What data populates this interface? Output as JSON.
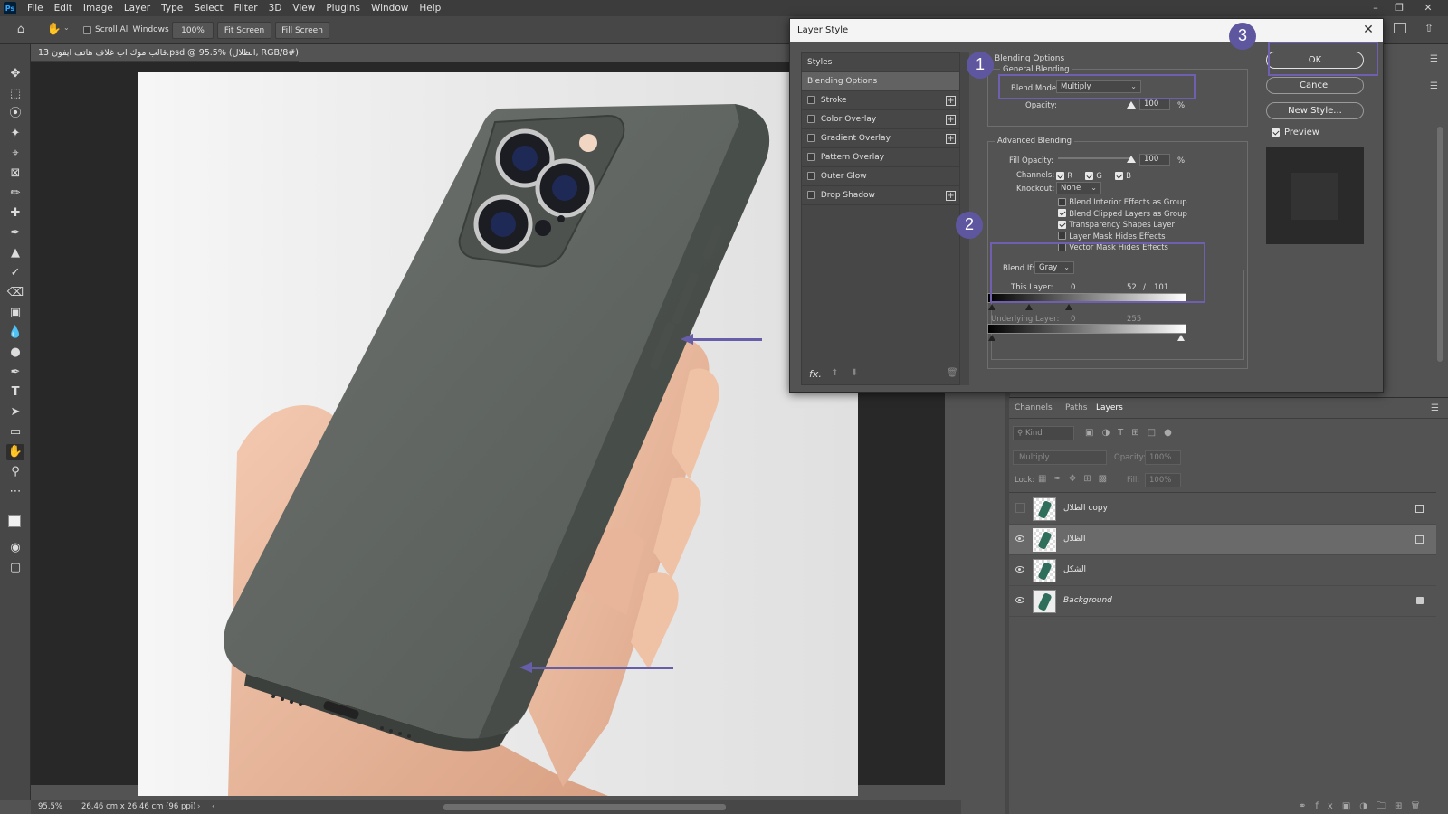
{
  "menubar": {
    "app_logo": "Ps",
    "items": [
      "File",
      "Edit",
      "Image",
      "Layer",
      "Type",
      "Select",
      "Filter",
      "3D",
      "View",
      "Plugins",
      "Window",
      "Help"
    ]
  },
  "optionsbar": {
    "scroll_all_windows": "Scroll All Windows",
    "zoom": "100%",
    "fit_screen": "Fit Screen",
    "fill_screen": "Fill Screen"
  },
  "document": {
    "tab_title": "قالب موك اب غلاف هاتف ايفون 13.psd @ 95.5% (الظلال, RGB/8#) *",
    "status_zoom": "95.5%",
    "status_size": "26.46 cm x 26.46 cm (96 ppi)"
  },
  "dialog": {
    "title": "Layer Style",
    "styles_header": "Styles",
    "style_items": [
      {
        "label": "Blending Options",
        "checkbox": false,
        "plus": false
      },
      {
        "label": "Stroke",
        "checkbox": true,
        "plus": true
      },
      {
        "label": "Color Overlay",
        "checkbox": true,
        "plus": true
      },
      {
        "label": "Gradient Overlay",
        "checkbox": true,
        "plus": true
      },
      {
        "label": "Pattern Overlay",
        "checkbox": true,
        "plus": false
      },
      {
        "label": "Outer Glow",
        "checkbox": true,
        "plus": false
      },
      {
        "label": "Drop Shadow",
        "checkbox": true,
        "plus": true
      }
    ],
    "fx_label": "fx.",
    "blending_options": "Blending Options",
    "general_blending": "General Blending",
    "blend_mode_label": "Blend Mode:",
    "blend_mode_value": "Multiply",
    "opacity_label": "Opacity:",
    "opacity_value": "100",
    "percent": "%",
    "advanced_blending": "Advanced Blending",
    "fill_opacity_label": "Fill Opacity:",
    "fill_opacity_value": "100",
    "channels_label": "Channels:",
    "channels": [
      "R",
      "G",
      "B"
    ],
    "knockout_label": "Knockout:",
    "knockout_value": "None",
    "advanced_checks": [
      {
        "label": "Blend Interior Effects as Group",
        "checked": false
      },
      {
        "label": "Blend Clipped Layers as Group",
        "checked": true
      },
      {
        "label": "Transparency Shapes Layer",
        "checked": true
      },
      {
        "label": "Layer Mask Hides Effects",
        "checked": false
      },
      {
        "label": "Vector Mask Hides Effects",
        "checked": false
      }
    ],
    "blend_if_label": "Blend If:",
    "blend_if_value": "Gray",
    "this_layer_label": "This Layer:",
    "this_layer_low": "0",
    "this_layer_high_a": "52",
    "this_layer_sep": "/",
    "this_layer_high_b": "101",
    "underlying_label": "Underlying Layer:",
    "underlying_low": "0",
    "underlying_high": "255",
    "buttons": {
      "ok": "OK",
      "cancel": "Cancel",
      "new_style": "New Style..."
    },
    "preview_label": "Preview"
  },
  "layers_panel": {
    "tabs": [
      "Channels",
      "Paths",
      "Layers"
    ],
    "active_tab": "Layers",
    "kind_placeholder": "Kind",
    "blend_mode": "Multiply",
    "opacity_label": "Opacity:",
    "opacity_value": "100%",
    "lock_label": "Lock:",
    "fill_label": "Fill:",
    "fill_value": "100%",
    "layers": [
      {
        "name": "الظلال copy",
        "visible": false,
        "selected": false,
        "badge": "smart"
      },
      {
        "name": "الظلال",
        "visible": true,
        "selected": true,
        "badge": "smart"
      },
      {
        "name": "الشكل",
        "visible": true,
        "selected": false,
        "badge": ""
      },
      {
        "name": "Background",
        "visible": true,
        "selected": false,
        "badge": "lock"
      }
    ]
  },
  "annotations": {
    "badges": [
      "1",
      "2",
      "3"
    ],
    "color": "#6f5fae"
  }
}
